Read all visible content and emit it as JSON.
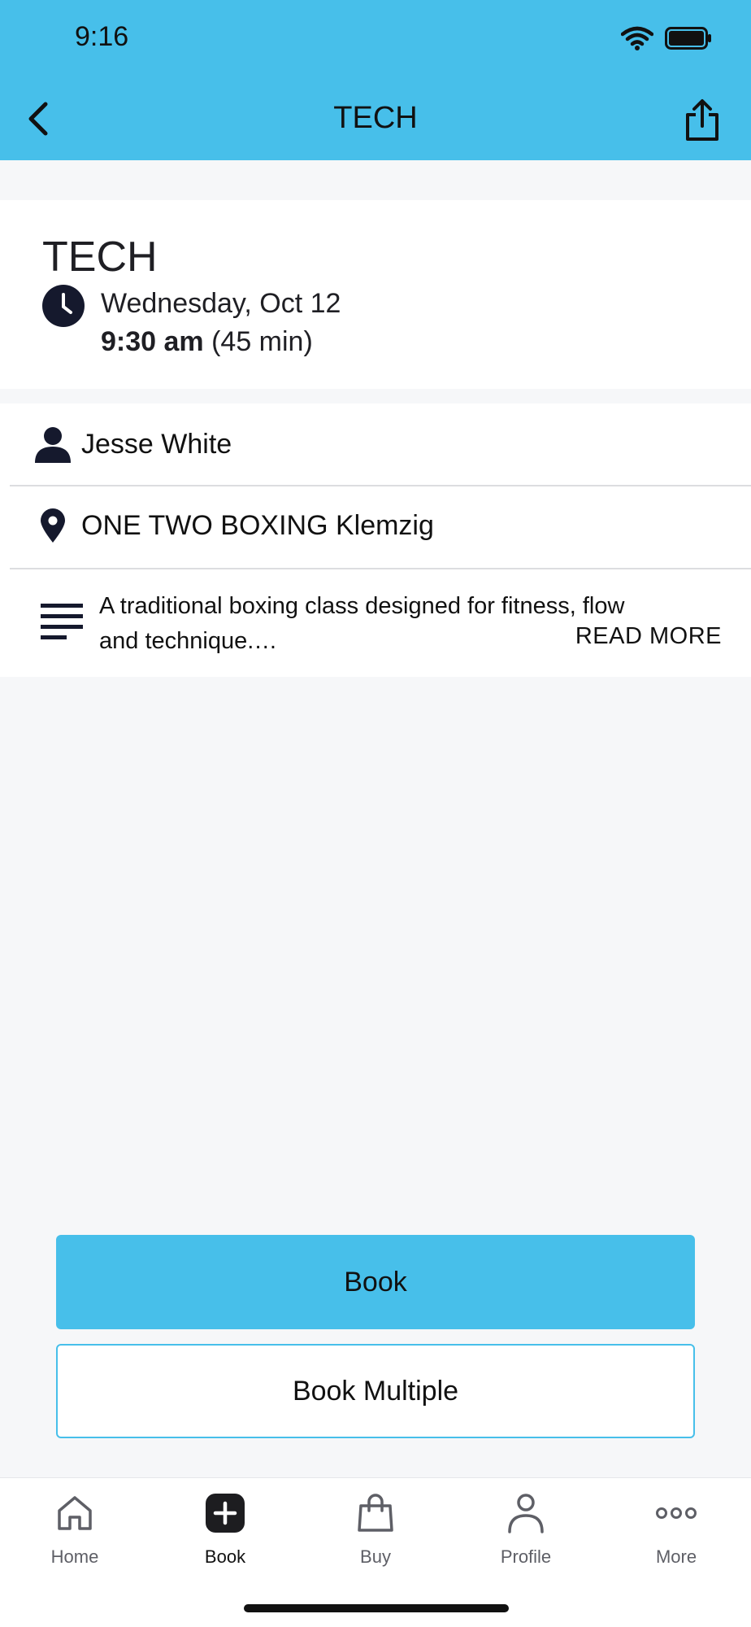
{
  "status_bar": {
    "time": "9:16"
  },
  "nav": {
    "title": "TECH"
  },
  "class_info": {
    "title": "TECH",
    "date": "Wednesday, Oct 12",
    "time": "9:30 am",
    "duration": "(45 min)"
  },
  "details": {
    "instructor": "Jesse White",
    "location": "ONE TWO BOXING Klemzig",
    "description": "A traditional boxing class designed for fitness, flow and technique.…",
    "read_more": "READ MORE"
  },
  "buttons": {
    "book": "Book",
    "book_multiple": "Book Multiple"
  },
  "tabbar": [
    {
      "label": "Home",
      "icon": "home-icon"
    },
    {
      "label": "Book",
      "icon": "plus-square-icon",
      "active": true
    },
    {
      "label": "Buy",
      "icon": "shopping-bag-icon"
    },
    {
      "label": "Profile",
      "icon": "person-icon"
    },
    {
      "label": "More",
      "icon": "more-dots-icon"
    }
  ],
  "colors": {
    "accent": "#47bfea",
    "icon_dark": "#15192d"
  }
}
